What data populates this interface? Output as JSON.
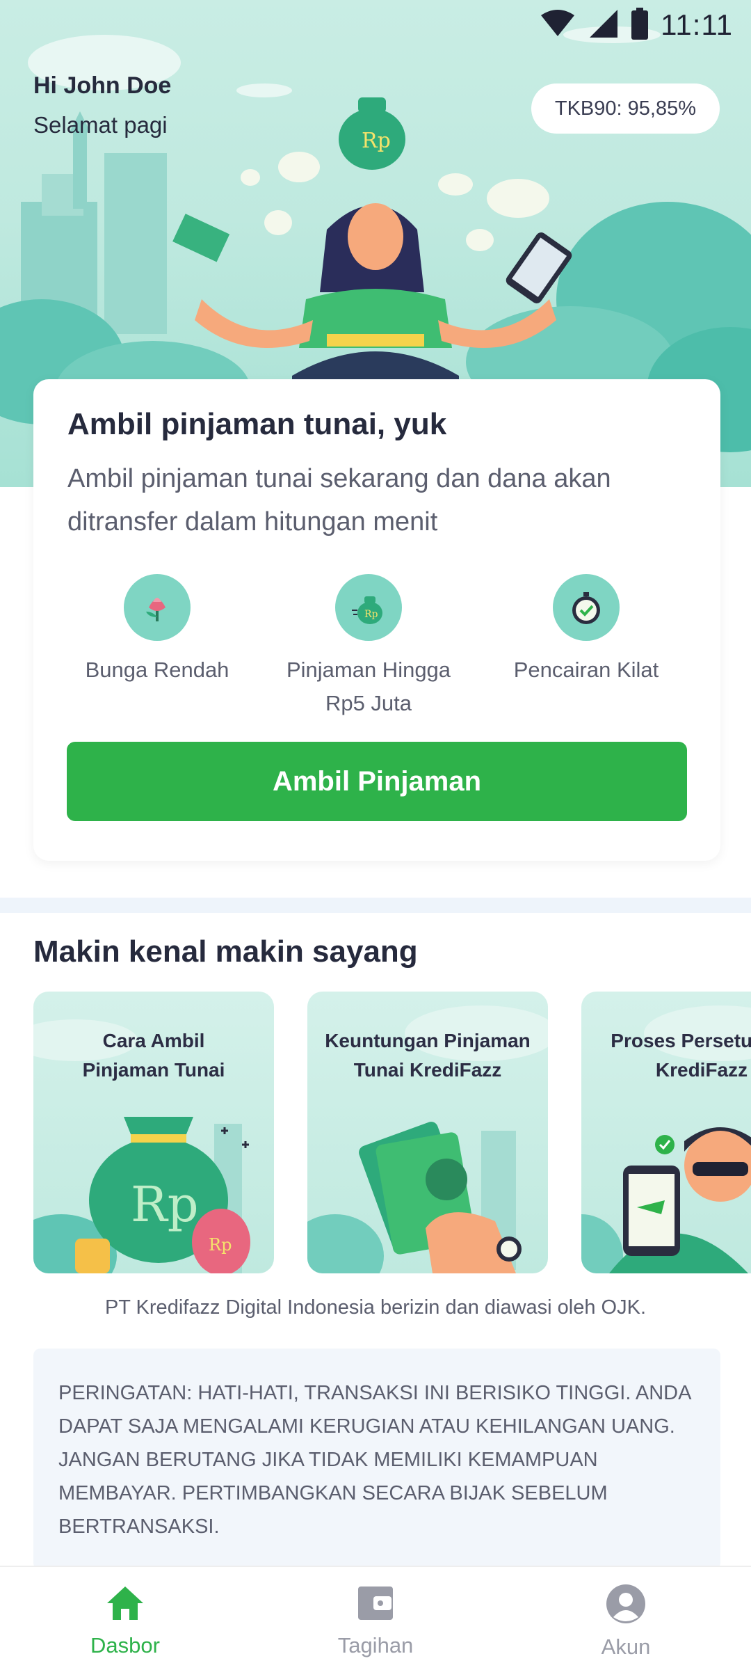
{
  "status_bar": {
    "time": "11:11",
    "icons": [
      "wifi-icon",
      "signal-icon",
      "battery-icon"
    ]
  },
  "greeting": {
    "name": "Hi John Doe",
    "subtitle": "Selamat pagi"
  },
  "tkb_badge": "TKB90: 95,85%",
  "loan_card": {
    "title": "Ambil pinjaman tunai, yuk",
    "description": "Ambil pinjaman tunai sekarang dan dana akan ditransfer dalam hitungan menit",
    "features": [
      {
        "label": "Bunga Rendah",
        "icon": "flower-icon"
      },
      {
        "label": "Pinjaman Hingga Rp5 Juta",
        "icon": "money-bag-icon"
      },
      {
        "label": "Pencairan Kilat",
        "icon": "stopwatch-icon"
      }
    ],
    "cta_label": "Ambil Pinjaman"
  },
  "section": {
    "title": "Makin kenal makin sayang",
    "cards": [
      {
        "title": "Cara Ambil\nPinjaman Tunai"
      },
      {
        "title": "Keuntungan Pinjaman\nTunai KrediFazz"
      },
      {
        "title": "Proses Persetujuan\nKrediFazz"
      }
    ]
  },
  "ojk_notice": "PT Kredifazz Digital Indonesia berizin dan diawasi oleh OJK.",
  "warning": "PERINGATAN: HATI-HATI, TRANSAKSI INI BERISIKO TINGGI. ANDA DAPAT SAJA MENGALAMI KERUGIAN ATAU KEHILANGAN UANG. JANGAN BERUTANG JIKA TIDAK MEMILIKI KEMAMPUAN MEMBAYAR. PERTIMBANGKAN SECARA BIJAK SEBELUM BERTRANSAKSI.",
  "bottom_nav": {
    "items": [
      {
        "label": "Dasbor",
        "icon": "home-icon",
        "active": true
      },
      {
        "label": "Tagihan",
        "icon": "wallet-icon",
        "active": false
      },
      {
        "label": "Akun",
        "icon": "account-icon",
        "active": false
      }
    ]
  },
  "colors": {
    "primary_green": "#2eb24a",
    "teal": "#7fd5c3",
    "hero_bg": "#c9ede4",
    "text_dark": "#262a3d"
  }
}
